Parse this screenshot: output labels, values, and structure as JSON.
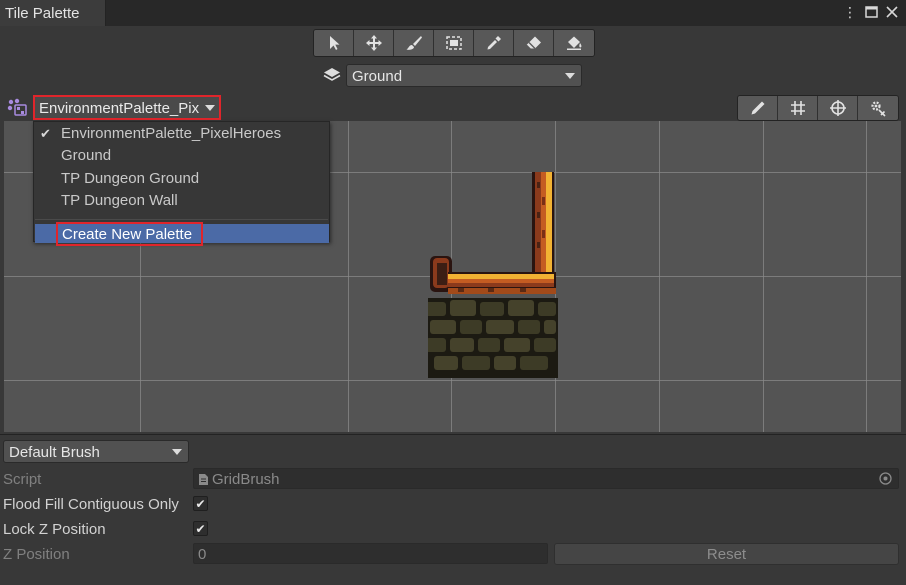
{
  "window": {
    "tab_title": "Tile Palette"
  },
  "toolbar": {
    "tools": [
      "select-icon",
      "move-icon",
      "paint-brush-icon",
      "box-fill-icon",
      "picker-icon",
      "eraser-icon",
      "fill-bucket-icon"
    ]
  },
  "layer": {
    "selected": "Ground"
  },
  "palette": {
    "selected": "EnvironmentPalette_Pix",
    "options": [
      "EnvironmentPalette_PixelHeroes",
      "Ground",
      "TP Dungeon Ground",
      "TP Dungeon Wall"
    ],
    "create_new": "Create New Palette"
  },
  "palette_tools": [
    "edit-icon",
    "grid-icon",
    "gizmo-icon",
    "settings-icon"
  ],
  "brush": {
    "selected": "Default Brush",
    "script_label": "Script",
    "script_value": "GridBrush",
    "flood_fill_label": "Flood Fill Contiguous Only",
    "flood_fill_checked": true,
    "lock_z_label": "Lock Z Position",
    "lock_z_checked": true,
    "z_position_label": "Z Position",
    "z_position_value": "0",
    "reset_label": "Reset"
  },
  "colors": {
    "highlight": "#e0252b",
    "selection": "#4b6aa6"
  }
}
